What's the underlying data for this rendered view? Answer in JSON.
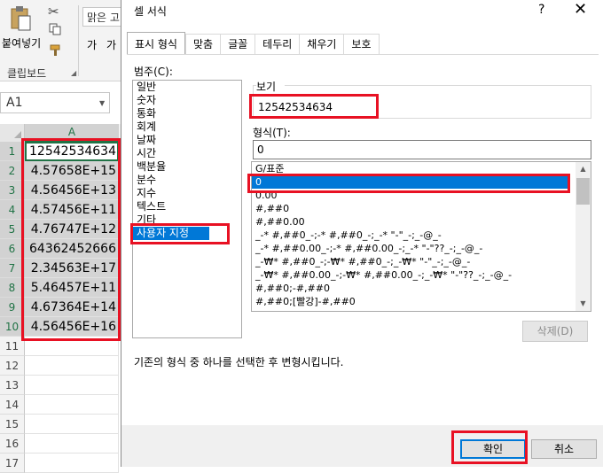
{
  "excel": {
    "ribbon": {
      "paste_label": "붙여넣기",
      "clipboard_group_label": "클립보드",
      "font_name": "맑은 고",
      "bold_label": "가",
      "italic_label": "가"
    },
    "name_box": "A1",
    "column_header": "A",
    "rows": [
      {
        "num": "1",
        "value": "12542534634"
      },
      {
        "num": "2",
        "value": "4.57658E+15"
      },
      {
        "num": "3",
        "value": "4.56456E+13"
      },
      {
        "num": "4",
        "value": "4.57456E+11"
      },
      {
        "num": "5",
        "value": "4.76747E+12"
      },
      {
        "num": "6",
        "value": "64362452666"
      },
      {
        "num": "7",
        "value": "2.34563E+17"
      },
      {
        "num": "8",
        "value": "5.46457E+11"
      },
      {
        "num": "9",
        "value": "4.67364E+14"
      },
      {
        "num": "10",
        "value": "4.56456E+16"
      },
      {
        "num": "11",
        "value": ""
      },
      {
        "num": "12",
        "value": ""
      },
      {
        "num": "13",
        "value": ""
      },
      {
        "num": "14",
        "value": ""
      },
      {
        "num": "15",
        "value": ""
      },
      {
        "num": "16",
        "value": ""
      },
      {
        "num": "17",
        "value": ""
      }
    ]
  },
  "dialog": {
    "title": "셀 서식",
    "help": "?",
    "close": "✕",
    "tabs": [
      "표시 형식",
      "맞춤",
      "글꼴",
      "테두리",
      "채우기",
      "보호"
    ],
    "category_label": "범주(C):",
    "categories": [
      "일반",
      "숫자",
      "통화",
      "회계",
      "날짜",
      "시간",
      "백분율",
      "분수",
      "지수",
      "텍스트",
      "기타",
      "사용자 지정"
    ],
    "selected_category": "사용자 지정",
    "sample_label": "보기",
    "sample_value": "12542534634",
    "type_label": "형식(T):",
    "type_value": "0",
    "formats": [
      "G/표준",
      "0",
      "0.00",
      "#,##0",
      "#,##0.00",
      "_-* #,##0_-;-* #,##0_-;_-* \"-\"_-;_-@_-",
      "_-* #,##0.00_-;-* #,##0.00_-;_-* \"-\"??_-;_-@_-",
      "_-₩* #,##0_-;-₩* #,##0_-;_-₩* \"-\"_-;_-@_-",
      "_-₩* #,##0.00_-;-₩* #,##0.00_-;_-₩* \"-\"??_-;_-@_-",
      "#,##0;-#,##0",
      "#,##0;[빨강]-#,##0"
    ],
    "selected_format": "0",
    "delete_label": "삭제(D)",
    "description": "기존의 형식 중 하나를 선택한 후 변형시킵니다.",
    "ok_label": "확인",
    "cancel_label": "취소"
  },
  "colors": {
    "highlight": "#e81123",
    "selection": "#0078d7",
    "excel_green": "#217346"
  }
}
